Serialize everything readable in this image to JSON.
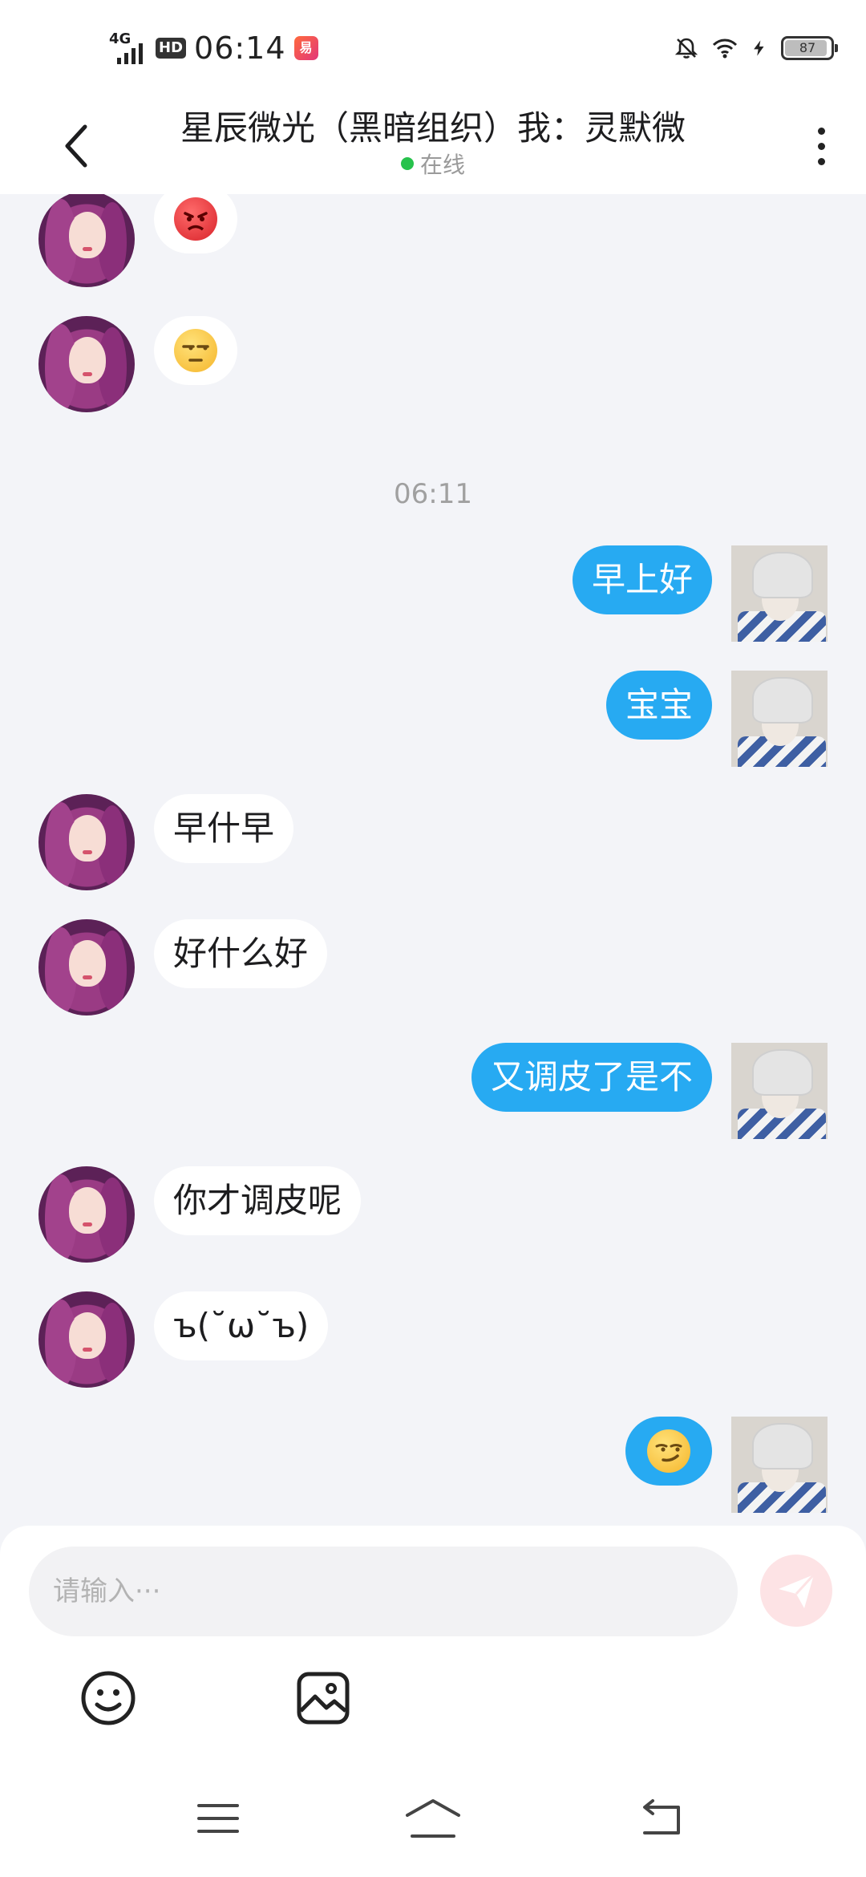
{
  "status_bar": {
    "network": "4G",
    "hd": "HD",
    "time": "06:14",
    "app_badge": "易",
    "battery": "87"
  },
  "header": {
    "title": "星辰微光（黑暗组织）我：灵默微",
    "status": "在线",
    "status_color": "#27c24c"
  },
  "chat": {
    "timestamp": "06:11",
    "messages": [
      {
        "side": "in",
        "type": "emoji",
        "icon": "angry-emoji"
      },
      {
        "side": "in",
        "type": "emoji",
        "icon": "unamused-emoji"
      },
      {
        "side": "out",
        "type": "text",
        "text": "早上好"
      },
      {
        "side": "out",
        "type": "text",
        "text": "宝宝"
      },
      {
        "side": "in",
        "type": "text",
        "text": "早什早"
      },
      {
        "side": "in",
        "type": "text",
        "text": "好什么好"
      },
      {
        "side": "out",
        "type": "text",
        "text": "又调皮了是不"
      },
      {
        "side": "in",
        "type": "text",
        "text": "你才调皮呢"
      },
      {
        "side": "in",
        "type": "text",
        "text": "ъ(˘ω˘ъ)"
      },
      {
        "side": "out",
        "type": "emoji",
        "icon": "smirk-emoji"
      }
    ]
  },
  "composer": {
    "placeholder": "请输入···",
    "send_icon": "send-icon",
    "tools": [
      "emoji-picker-icon",
      "image-picker-icon"
    ]
  },
  "colors": {
    "outgoing_bubble": "#27aaf2",
    "incoming_bubble": "#ffffff",
    "background": "#f3f4f8"
  },
  "nav": [
    "menu-icon",
    "home-icon",
    "back-icon"
  ]
}
